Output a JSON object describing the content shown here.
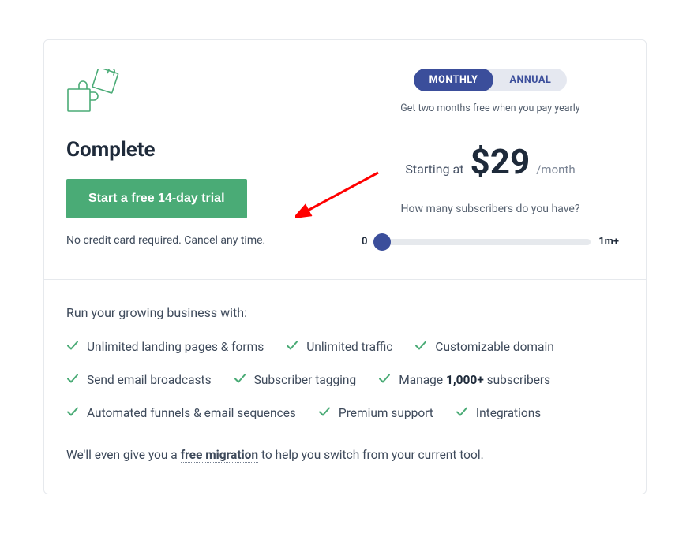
{
  "plan": {
    "title": "Complete",
    "cta_label": "Start a free 14-day trial",
    "cta_note": "No credit card required. Cancel any time."
  },
  "billing": {
    "monthly_label": "MONTHLY",
    "annual_label": "ANNUAL",
    "yearly_note": "Get two months free when you pay yearly"
  },
  "pricing": {
    "prefix": "Starting at",
    "amount": "$29",
    "period": "/month"
  },
  "slider": {
    "question": "How many subscribers do you have?",
    "min_label": "0",
    "max_label": "1m+"
  },
  "features": {
    "heading": "Run your growing business with:",
    "items": [
      {
        "text": "Unlimited landing pages & forms"
      },
      {
        "text": "Unlimited traffic"
      },
      {
        "text": "Customizable domain"
      },
      {
        "text": "Send email broadcasts"
      },
      {
        "text": "Subscriber tagging"
      },
      {
        "text_prefix": "Manage ",
        "bold": "1,000+",
        "text_suffix": " subscribers"
      },
      {
        "text": "Automated funnels & email sequences"
      },
      {
        "text": "Premium support"
      },
      {
        "text": "Integrations"
      }
    ],
    "migration_prefix": "We'll even give you a ",
    "migration_link": "free migration",
    "migration_suffix": " to help you switch from your current tool."
  }
}
